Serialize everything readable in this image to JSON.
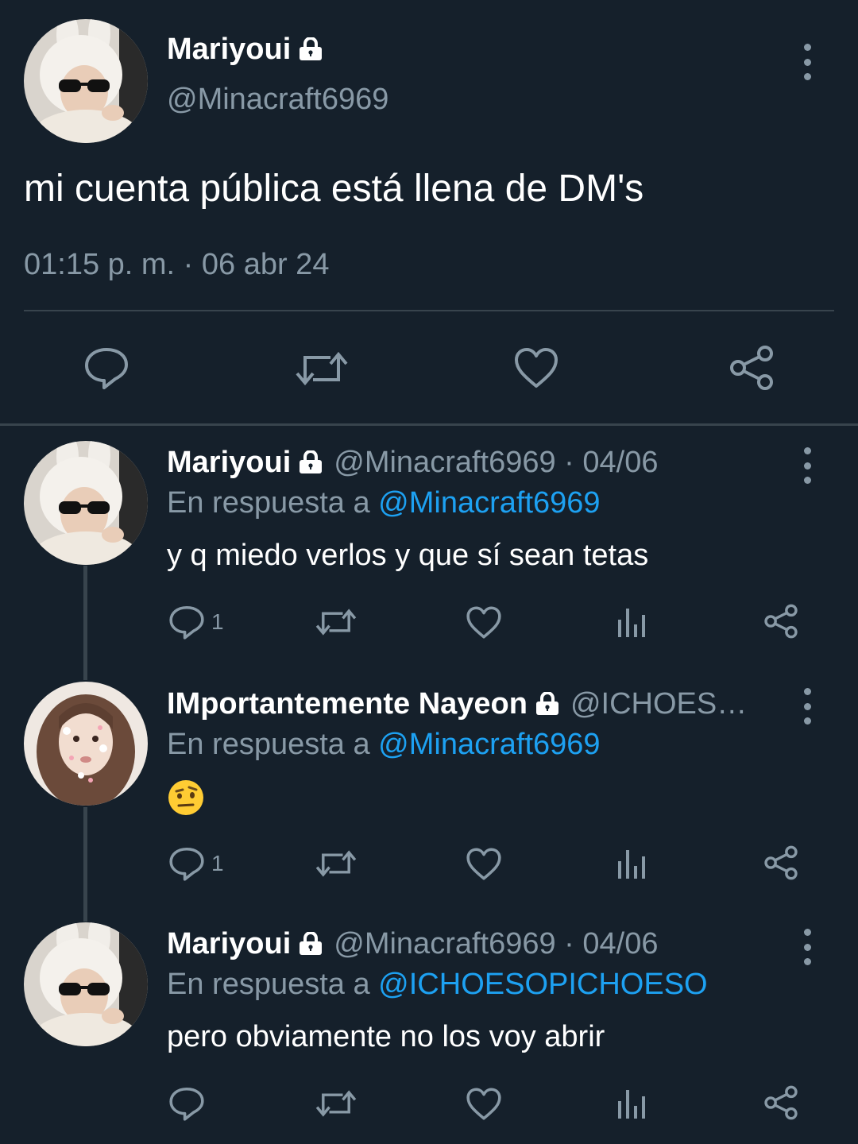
{
  "colors": {
    "background": "#15202b",
    "muted": "#8899a6",
    "link": "#1da1f2",
    "divider": "#38444d"
  },
  "main_tweet": {
    "display_name": "Mariyoui",
    "handle": "@Minacraft6969",
    "text": "mi cuenta pública está llena de DM's",
    "timestamp": "01:15 p. m. · 06 abr 24",
    "icons": [
      "lock-icon",
      "more-icon",
      "reply-icon",
      "retweet-icon",
      "like-icon",
      "share-icon"
    ]
  },
  "replies": [
    {
      "display_name": "Mariyoui",
      "meta": "@Minacraft6969 · 04/06",
      "reply_prefix": "En respuesta a",
      "reply_to": "@Minacraft6969",
      "text": "y q miedo verlos y que sí sean tetas",
      "reply_count": "1"
    },
    {
      "display_name": "IMportantemente Nayeon",
      "meta": "@ICHOES…",
      "reply_prefix": "En respuesta a",
      "reply_to": "@Minacraft6969",
      "text": "🤨",
      "reply_count": "1"
    },
    {
      "display_name": "Mariyoui",
      "meta": "@Minacraft6969 · 04/06",
      "reply_prefix": "En respuesta a",
      "reply_to": "@ICHOESOPICHOESO",
      "text": "pero obviamente no los voy abrir",
      "reply_count": ""
    }
  ]
}
